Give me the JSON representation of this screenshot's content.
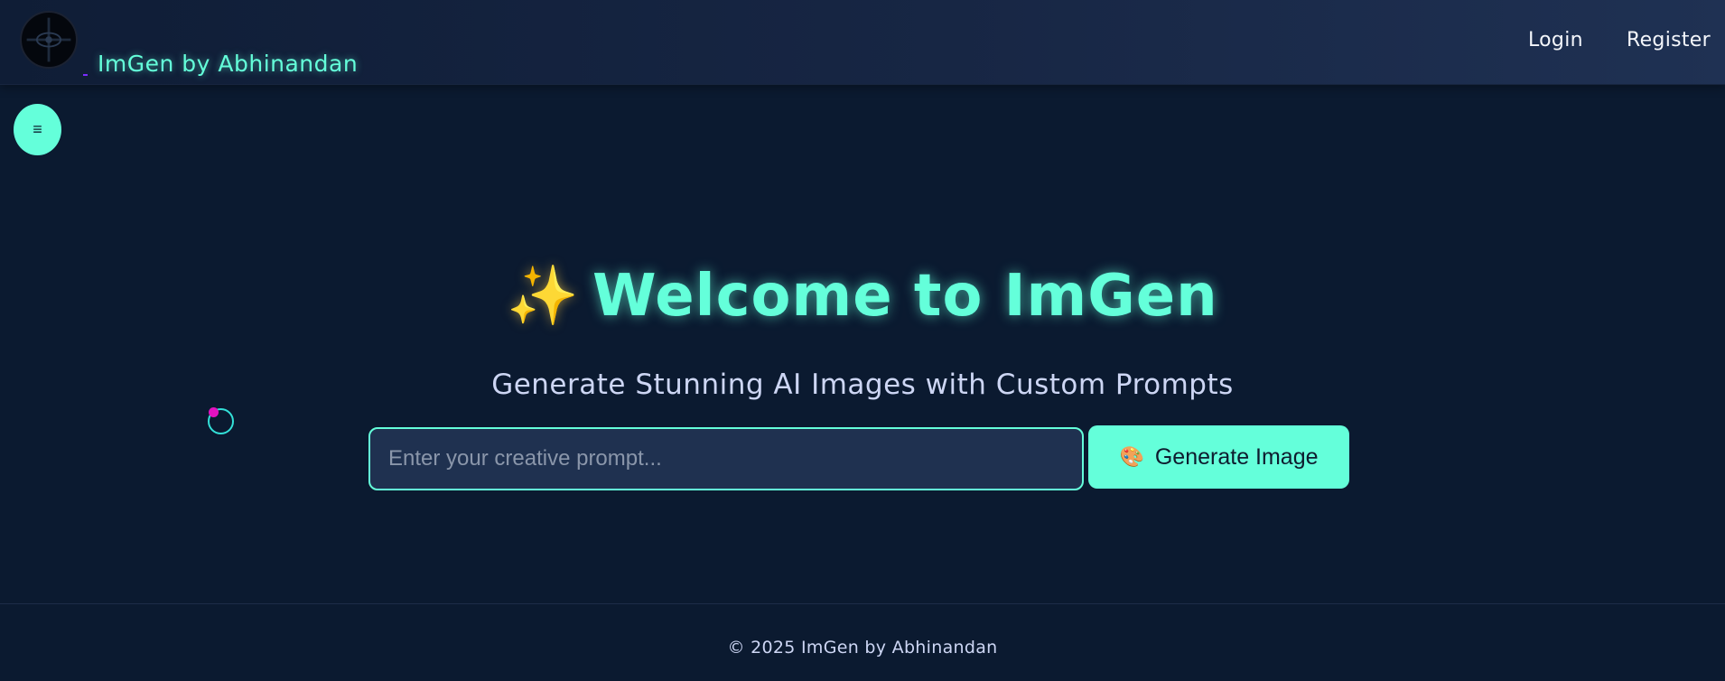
{
  "header": {
    "brand": "ImGen by Abhinandan",
    "logo_icon": "eye-emblem-icon",
    "nav": {
      "login": "Login",
      "register": "Register"
    }
  },
  "sidebar_toggle": {
    "icon": "menu-icon",
    "glyph": "≡"
  },
  "hero": {
    "sparkle": "✨",
    "title": "Welcome to ImGen",
    "subtitle": "Generate Stunning AI Images with Custom Prompts"
  },
  "prompt": {
    "placeholder": "Enter your creative prompt...",
    "value": ""
  },
  "generate_button": {
    "icon": "🎨",
    "label": "Generate Image"
  },
  "footer": {
    "text": "© 2025 ImGen by Abhinandan"
  },
  "colors": {
    "background": "#0b1a30",
    "accent": "#64ffda",
    "input_bg": "#1f3150",
    "cursor_dot": "#e312c0"
  }
}
